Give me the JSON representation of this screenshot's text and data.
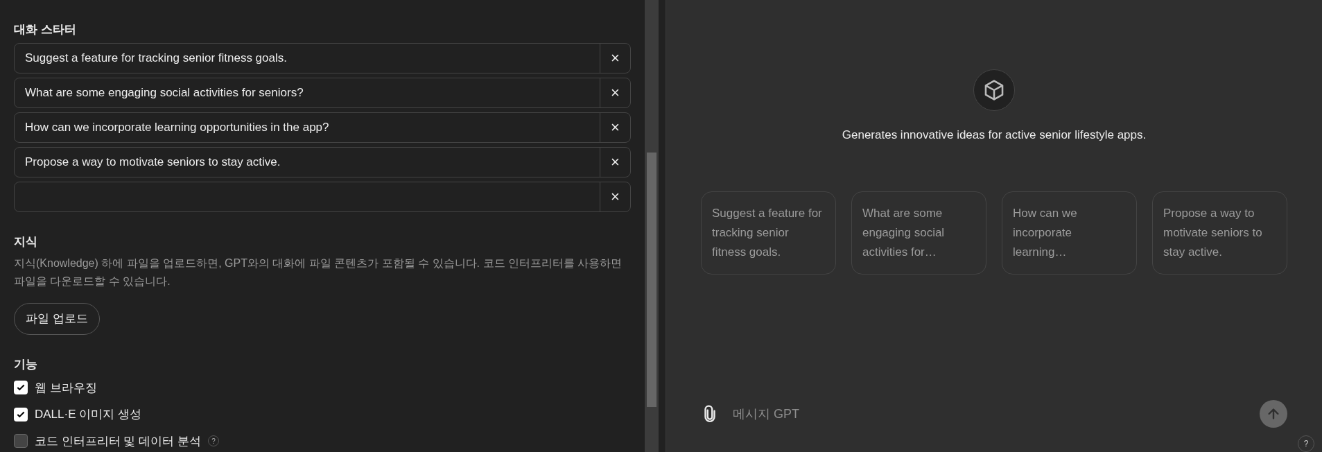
{
  "starters": {
    "title": "대화 스타터",
    "items": [
      {
        "value": "Suggest a feature for tracking senior fitness goals."
      },
      {
        "value": "What are some engaging social activities for seniors?"
      },
      {
        "value": "How can we incorporate learning opportunities in the app?"
      },
      {
        "value": "Propose a way to motivate seniors to stay active."
      }
    ],
    "blank_row": true,
    "remove_label": "×"
  },
  "knowledge": {
    "title": "지식",
    "description": "지식(Knowledge) 하에 파일을 업로드하면, GPT와의 대화에 파일 콘텐츠가 포함될 수 있습니다. 코드 인터프리터를 사용하면 파일을 다운로드할 수 있습니다.",
    "upload_button": "파일 업로드"
  },
  "capabilities": {
    "title": "기능",
    "items": [
      {
        "label": "웹 브라우징",
        "checked": true,
        "help": false
      },
      {
        "label": "DALL·E 이미지 생성",
        "checked": true,
        "help": false
      },
      {
        "label": "코드 인터프리터 및 데이터 분석",
        "checked": false,
        "help": true
      }
    ],
    "help_label": "?"
  },
  "preview": {
    "description": "Generates innovative ideas for active senior lifestyle apps.",
    "cards": [
      "Suggest a feature for tracking senior fitness goals.",
      "What are some engaging social activities for…",
      "How can we incorporate learning…",
      "Propose a way to motivate seniors to stay active."
    ],
    "composer": {
      "placeholder": "메시지 GPT"
    },
    "help_button": "?"
  }
}
